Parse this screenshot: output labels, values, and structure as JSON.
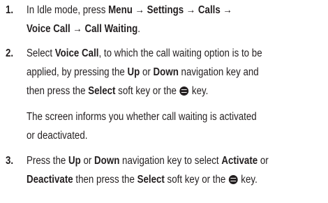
{
  "steps": [
    {
      "number": "1.",
      "line1": {
        "t1": "In Idle mode, press ",
        "b1": "Menu → Settings → Calls →"
      },
      "line2": {
        "b1": "Voice Call → Call Waiting",
        "t1": "."
      }
    },
    {
      "number": "2.",
      "line1": {
        "t1": "Select ",
        "b1": "Voice Call",
        "t2": ", to which the call waiting option is to be"
      },
      "line2": {
        "t1": "applied, by pressing the ",
        "b1": "Up",
        "t2": " or ",
        "b2": "Down",
        "t3": " navigation key and"
      },
      "line3": {
        "t1": "then press the ",
        "b1": "Select",
        "t2": " soft key or the ",
        "t3": " key."
      },
      "note_line1": "The screen informs you whether call waiting is activated",
      "note_line2": "or deactivated."
    },
    {
      "number": "3.",
      "line1": {
        "t1": "Press the ",
        "b1": "Up",
        "t2": " or ",
        "b2": "Down",
        "t3": " navigation key to select ",
        "b3": "Activate",
        "t4": " or"
      },
      "line2": {
        "b1": "Deactivate",
        "t1": " then press the ",
        "b2": "Select",
        "t2": " soft key or the ",
        "t3": " key."
      }
    }
  ],
  "icons": {
    "ok_key": "ok-key-icon"
  }
}
